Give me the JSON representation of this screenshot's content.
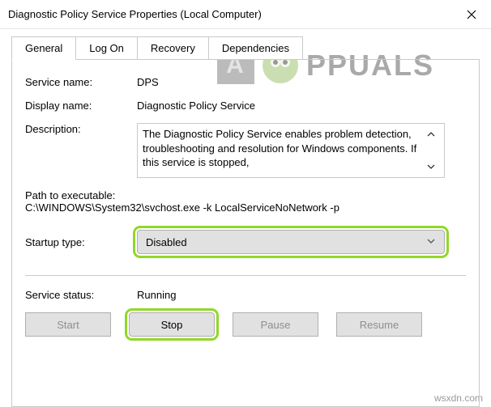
{
  "window": {
    "title": "Diagnostic Policy Service Properties (Local Computer)"
  },
  "tabs": {
    "t0": "General",
    "t1": "Log On",
    "t2": "Recovery",
    "t3": "Dependencies"
  },
  "labels": {
    "service_name": "Service name:",
    "display_name": "Display name:",
    "description": "Description:",
    "path_exec": "Path to executable:",
    "startup_type": "Startup type:",
    "service_status": "Service status:"
  },
  "values": {
    "service_name": "DPS",
    "display_name": "Diagnostic Policy Service",
    "description": "The Diagnostic Policy Service enables problem detection, troubleshooting and resolution for Windows components.  If this service is stopped,",
    "path_exec": "C:\\WINDOWS\\System32\\svchost.exe -k LocalServiceNoNetwork -p",
    "startup_type": "Disabled",
    "service_status": "Running"
  },
  "buttons": {
    "start": "Start",
    "stop": "Stop",
    "pause": "Pause",
    "resume": "Resume"
  },
  "watermark": {
    "text": "PPUALS",
    "footer": "wsxdn.com"
  }
}
